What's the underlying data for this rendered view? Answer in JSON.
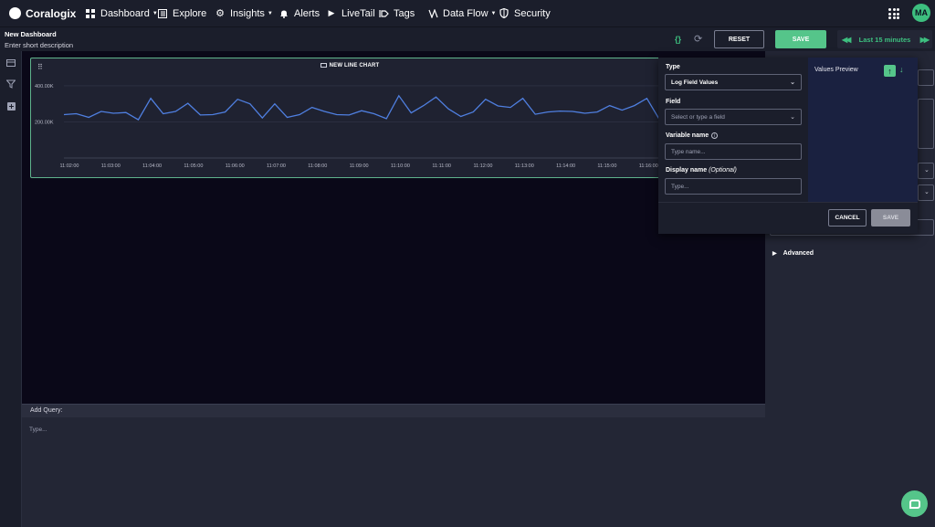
{
  "app": {
    "brand": "Coralogix"
  },
  "nav": [
    {
      "label": "Dashboard",
      "icon": "grid-icon",
      "dropdown": true
    },
    {
      "label": "Explore",
      "icon": "explore-icon",
      "dropdown": false
    },
    {
      "label": "Insights",
      "icon": "gear-icon",
      "dropdown": true
    },
    {
      "label": "Alerts",
      "icon": "bell-icon",
      "dropdown": false
    },
    {
      "label": "LiveTail",
      "icon": "play-icon",
      "dropdown": false
    },
    {
      "label": "Tags",
      "icon": "tag-icon",
      "dropdown": false
    },
    {
      "label": "Data Flow",
      "icon": "data-flow-icon",
      "dropdown": true
    },
    {
      "label": "Security",
      "icon": "shield-icon",
      "dropdown": false
    }
  ],
  "user": {
    "initials": "MA"
  },
  "dashboard": {
    "title": "New Dashboard",
    "description": "Enter short description"
  },
  "toolbar": {
    "reset_label": "RESET",
    "save_label": "SAVE",
    "time_range": "Last 15 minutes"
  },
  "widget": {
    "title": "NEW LINE CHART"
  },
  "query": {
    "label": "Add Query:",
    "placeholder": "Type..."
  },
  "panel": {
    "advanced_label": "Advanced"
  },
  "popup": {
    "type_label": "Type",
    "type_value": "Log Field Values",
    "field_label": "Field",
    "field_placeholder": "Select or type a field",
    "varname_label": "Variable name",
    "varname_placeholder": "Type name...",
    "display_label": "Display name",
    "display_optional": "(Optional)",
    "display_placeholder": "Type...",
    "preview_title": "Values Preview",
    "cancel_label": "CANCEL",
    "save_label": "SAVE"
  },
  "colors": {
    "accent": "#55c58a",
    "line": "#4f7fe0",
    "widget_border": "#5fb48c"
  },
  "chart_data": {
    "type": "line",
    "title": "NEW LINE CHART",
    "x_ticks": [
      "11:02:00",
      "11:03:00",
      "11:04:00",
      "11:05:00",
      "11:06:00",
      "11:07:00",
      "11:08:00",
      "11:09:00",
      "11:10:00",
      "11:11:00",
      "11:12:00",
      "11:13:00",
      "11:14:00",
      "11:15:00",
      "11:16:00"
    ],
    "y_ticks": [
      "400.00K",
      "200.00K"
    ],
    "ylim": [
      0,
      450000
    ],
    "grid": true,
    "series": [
      {
        "values": [
          240000,
          245000,
          225000,
          258000,
          248000,
          252000,
          212000,
          330000,
          245000,
          258000,
          303000,
          238000,
          240000,
          255000,
          325000,
          300000,
          222000,
          300000,
          225000,
          240000,
          280000,
          258000,
          240000,
          238000,
          262000,
          245000,
          218000,
          345000,
          250000,
          290000,
          338000,
          272000,
          230000,
          255000,
          325000,
          288000,
          280000,
          330000,
          242000,
          255000,
          260000,
          258000,
          248000,
          255000,
          290000,
          265000,
          290000,
          330000,
          215000
        ]
      }
    ]
  }
}
